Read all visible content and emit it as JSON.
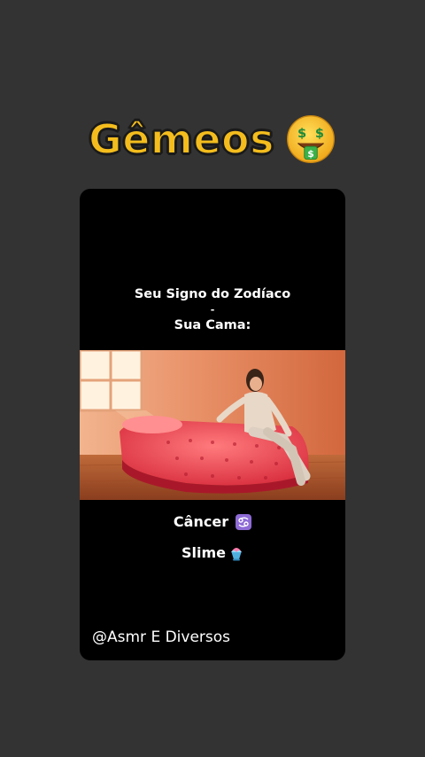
{
  "headline": {
    "text": "Gêmeos",
    "emoji": "money-mouth-face-icon",
    "color": "#f4bd1d"
  },
  "card": {
    "caption_line1": "Seu Signo do Zodíaco",
    "caption_line2": "-",
    "caption_line3": "Sua Cama:",
    "sign_label": "Câncer",
    "sign_icon": "cancer-zodiac-icon",
    "item_label": "Slime",
    "item_icon": "shaved-ice-icon",
    "handle": "@Asmr E Diversos"
  }
}
